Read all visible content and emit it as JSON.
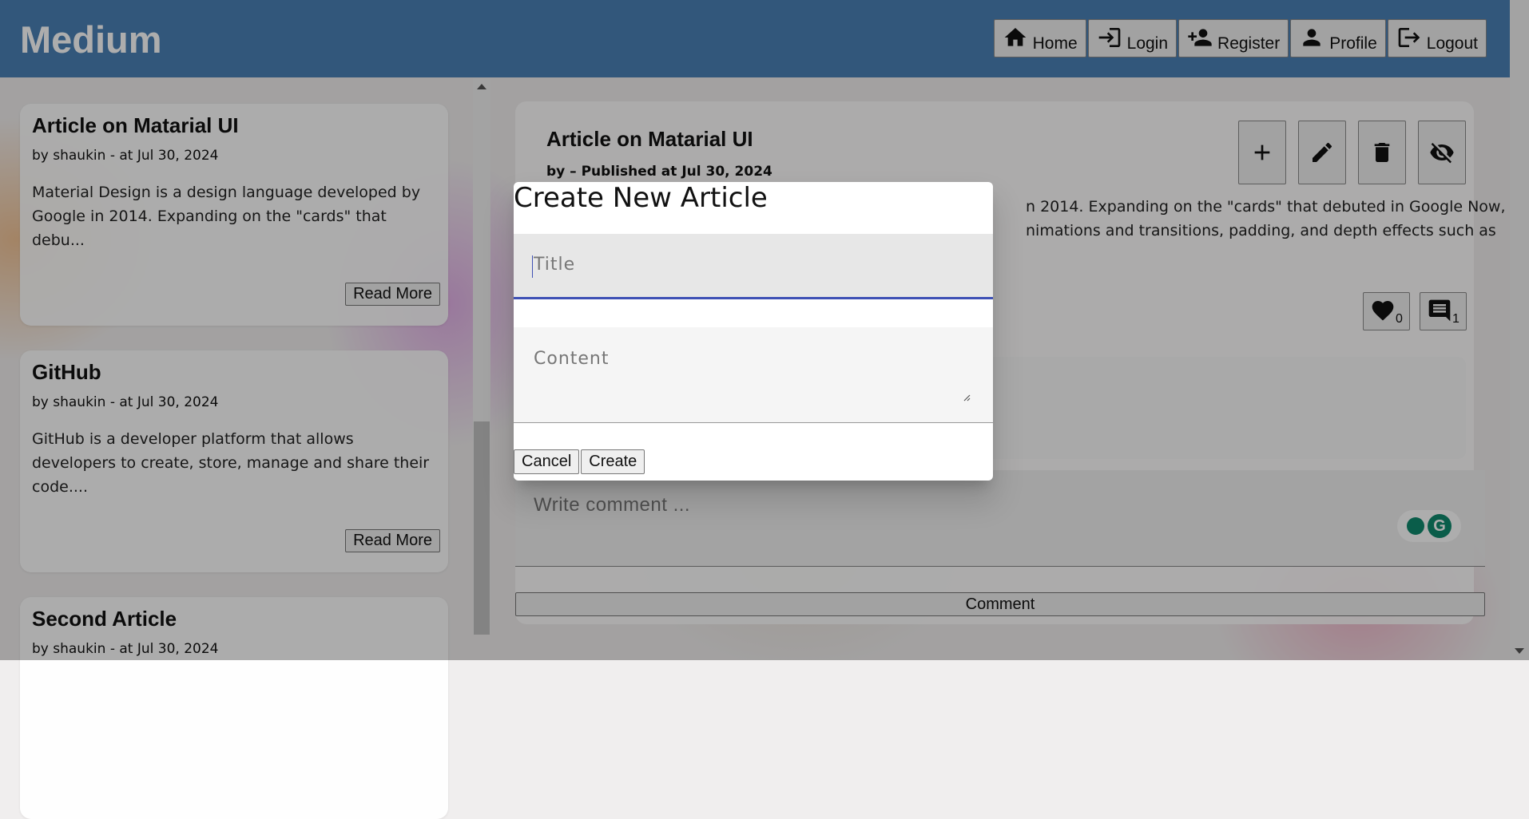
{
  "app": {
    "brand": "Medium"
  },
  "nav": {
    "items": [
      {
        "label": "Home",
        "icon": "home-icon"
      },
      {
        "label": "Login",
        "icon": "login-icon"
      },
      {
        "label": "Register",
        "icon": "person-add-icon"
      },
      {
        "label": "Profile",
        "icon": "person-icon"
      },
      {
        "label": "Logout",
        "icon": "logout-icon"
      }
    ]
  },
  "articles": [
    {
      "title": "Article on Matarial UI",
      "meta": "by shaukin - at Jul 30, 2024",
      "excerpt": "Material Design is a design language developed by Google in 2014. Expanding on the \"cards\" that debu...",
      "read_more": "Read More"
    },
    {
      "title": "GitHub",
      "meta": "by shaukin - at Jul 30, 2024",
      "excerpt": "GitHub is a developer platform that allows developers to create, store, manage and share their code....",
      "read_more": "Read More"
    },
    {
      "title": "Second Article",
      "meta": "by shaukin - at Jul 30, 2024",
      "excerpt": "",
      "read_more": ""
    }
  ],
  "detail": {
    "title": "Article on Matarial UI",
    "meta": "by – Published at Jul 30, 2024",
    "body_line1": "n 2014. Expanding on the \"cards\" that debuted in Google Now,",
    "body_line2": "nimations and transitions, padding, and depth effects such as",
    "likes": "0",
    "comments": "1",
    "comment_placeholder": "Write comment ...",
    "comment_button": "Comment",
    "actions": [
      "add-icon",
      "edit-icon",
      "delete-icon",
      "visibility-off-icon"
    ]
  },
  "dialog": {
    "title": "Create New Article",
    "title_placeholder": "Title",
    "content_placeholder": "Content",
    "cancel_label": "Cancel",
    "create_label": "Create"
  },
  "colors": {
    "header": "#4a80b6",
    "focus_underline": "#3f51b5",
    "grammarly": "#0f8a6e"
  }
}
